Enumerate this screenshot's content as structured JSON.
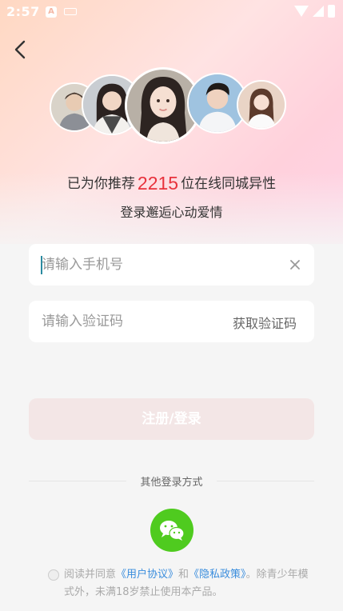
{
  "status_bar": {
    "time": "2:57",
    "app_icon": "A"
  },
  "promo": {
    "prefix": "已为你推荐",
    "count": "2215",
    "suffix": "位在线同城异性",
    "line2": "登录邂逅心动爱情"
  },
  "phone_field": {
    "placeholder": "请输入手机号",
    "value": ""
  },
  "code_field": {
    "placeholder": "请输入验证码",
    "value": "",
    "get_code_label": "获取验证码"
  },
  "submit_label": "注册/登录",
  "other_login_label": "其他登录方式",
  "agreement": {
    "prefix": "阅读并同意",
    "user_agreement": "《用户协议》",
    "and": "和",
    "privacy_policy": "《隐私政策》",
    "suffix": "。除青少年模式外，未满18岁禁止使用本产品。"
  },
  "colors": {
    "accent_red": "#e8323c",
    "wechat_green": "#4fcb1f",
    "link_blue": "#3a8ddd",
    "button_disabled": "#f3e6e6"
  },
  "icons": [
    "back-arrow-icon",
    "clear-icon",
    "wechat-icon",
    "wifi-icon",
    "signal-icon",
    "battery-icon",
    "keyboard-icon"
  ]
}
